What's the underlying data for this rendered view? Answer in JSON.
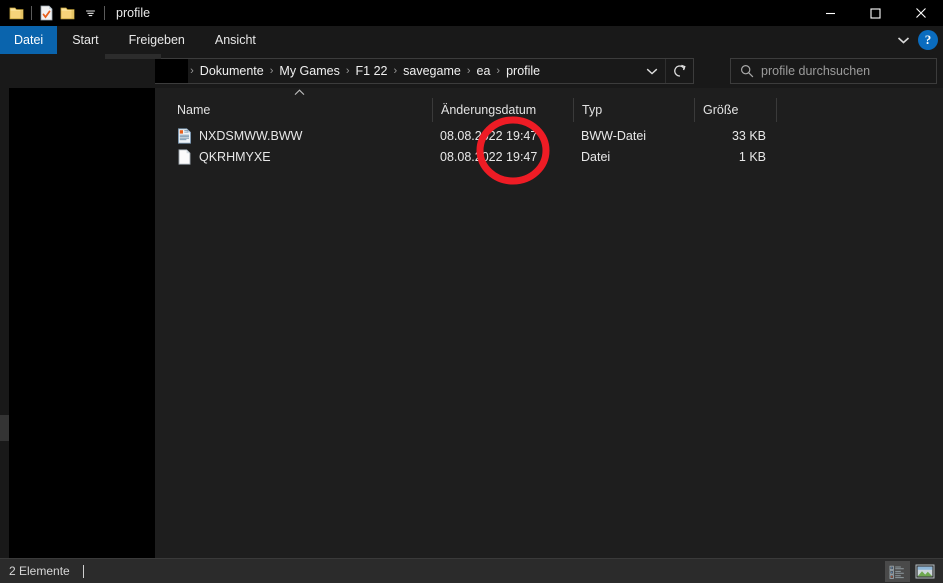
{
  "window": {
    "title": "profile",
    "controls": {
      "minimize": "—",
      "maximize": "☐",
      "close": "✕"
    },
    "quick_access": [
      {
        "name": "folder-icon",
        "label": ""
      },
      {
        "name": "properties-icon",
        "label": ""
      },
      {
        "name": "new-folder-icon",
        "label": ""
      },
      {
        "name": "customize-dropdown-icon",
        "label": "▾"
      }
    ]
  },
  "ribbon": {
    "tabs": [
      {
        "label": "Datei",
        "active": true
      },
      {
        "label": "Start",
        "active": false
      },
      {
        "label": "Freigeben",
        "active": false
      },
      {
        "label": "Ansicht",
        "active": false
      }
    ],
    "expand_icon": "⌄",
    "help_label": "?",
    "accent": "#0a64ad"
  },
  "navbar": {
    "back_icon": "←",
    "forward_icon": "→",
    "recent_icon": "⌄",
    "up_icon": "↑",
    "address": {
      "previous_chevrons": "«",
      "crumbs": [
        {
          "label": "",
          "redacted": true
        },
        {
          "label": "Dokumente",
          "redacted": false
        },
        {
          "label": "My Games",
          "redacted": false
        },
        {
          "label": "F1 22",
          "redacted": false
        },
        {
          "label": "savegame",
          "redacted": false
        },
        {
          "label": "ea",
          "redacted": false
        },
        {
          "label": "profile",
          "redacted": false
        }
      ],
      "separator": "›",
      "dropdown_icon": "⌄",
      "refresh_icon": "↻"
    },
    "search": {
      "placeholder": "profile durchsuchen",
      "value": "",
      "icon": "search-icon"
    }
  },
  "navigation_pane": {
    "redacted": true,
    "items": []
  },
  "filelist": {
    "sort_column": "Name",
    "sort_direction": "ascending",
    "sort_caret": "˄",
    "columns": [
      {
        "key": "name",
        "label": "Name"
      },
      {
        "key": "date",
        "label": "Änderungsdatum"
      },
      {
        "key": "type",
        "label": "Typ"
      },
      {
        "key": "size",
        "label": "Größe"
      }
    ],
    "rows": [
      {
        "icon": "bww-file-icon",
        "name": "NXDSMWW.BWW",
        "date": "08.08.2022 19:47",
        "type": "BWW-Datei",
        "size": "33 KB"
      },
      {
        "icon": "generic-file-icon",
        "name": "QKRHMYXE",
        "date": "08.08.2022 19:47",
        "type": "Datei",
        "size": "1 KB"
      }
    ]
  },
  "statusbar": {
    "item_count_text": "2 Elemente",
    "view_details_icon": "details-view-icon",
    "view_large_icons_icon": "large-icons-view-icon",
    "active_view": "details"
  },
  "annotation": {
    "shape": "ellipse",
    "color": "#ee1c25",
    "stroke_width": 7,
    "target": "modification time column values"
  }
}
